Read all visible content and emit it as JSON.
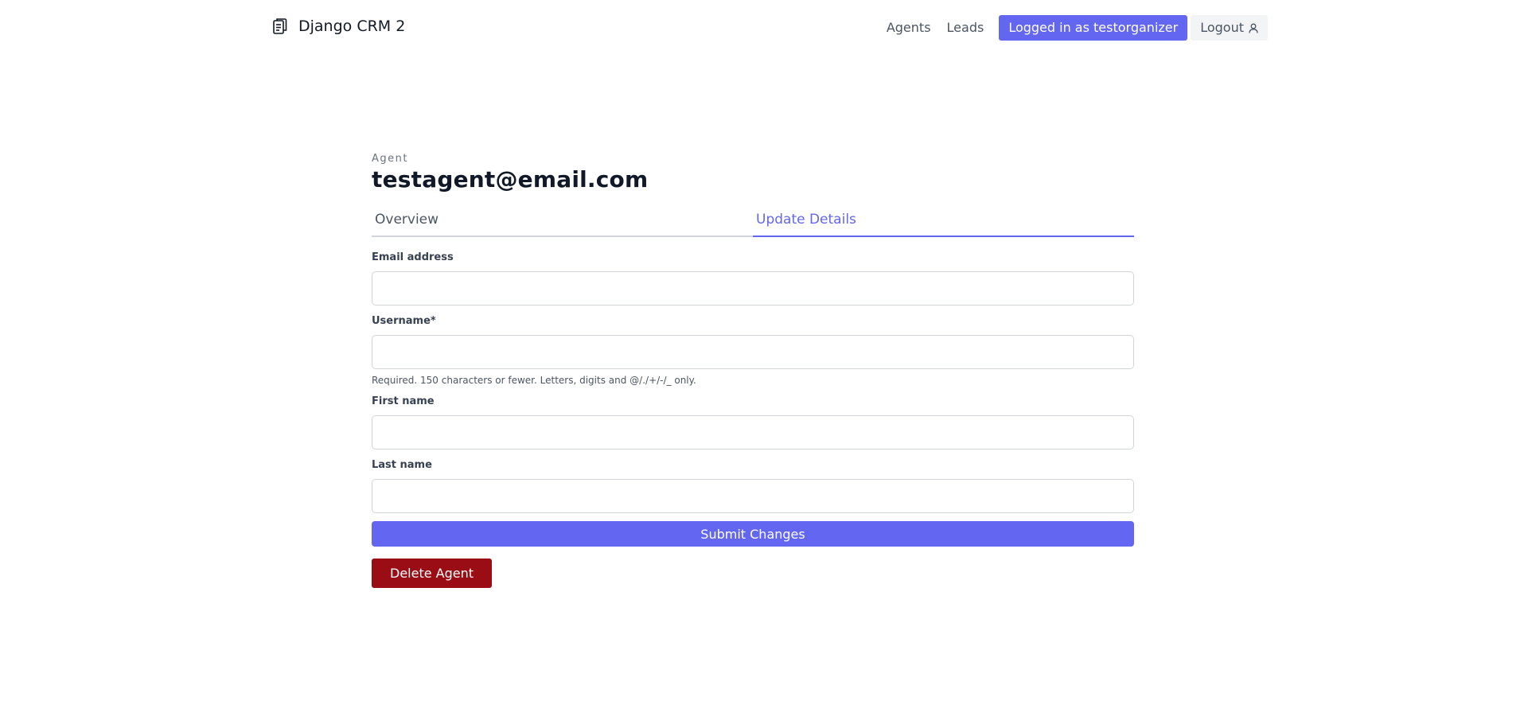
{
  "header": {
    "brand": "Django CRM 2",
    "brand_icon": "clipboard-icon",
    "nav": {
      "agents": "Agents",
      "leads": "Leads",
      "logged_in": "Logged in as testorganizer",
      "logout": "Logout",
      "logout_icon": "user-icon"
    }
  },
  "page": {
    "eyebrow": "Agent",
    "title": "testagent@email.com",
    "tabs": [
      {
        "label": "Overview",
        "active": false
      },
      {
        "label": "Update Details",
        "active": true
      }
    ]
  },
  "form": {
    "email": {
      "label": "Email address",
      "value": ""
    },
    "username": {
      "label": "Username*",
      "value": "",
      "help": "Required. 150 characters or fewer. Letters, digits and @/./+/-/_ only."
    },
    "first_name": {
      "label": "First name",
      "value": ""
    },
    "last_name": {
      "label": "Last name",
      "value": ""
    },
    "submit": "Submit Changes",
    "delete": "Delete Agent"
  },
  "colors": {
    "accent": "#6366f1",
    "danger": "#9b0d14"
  }
}
